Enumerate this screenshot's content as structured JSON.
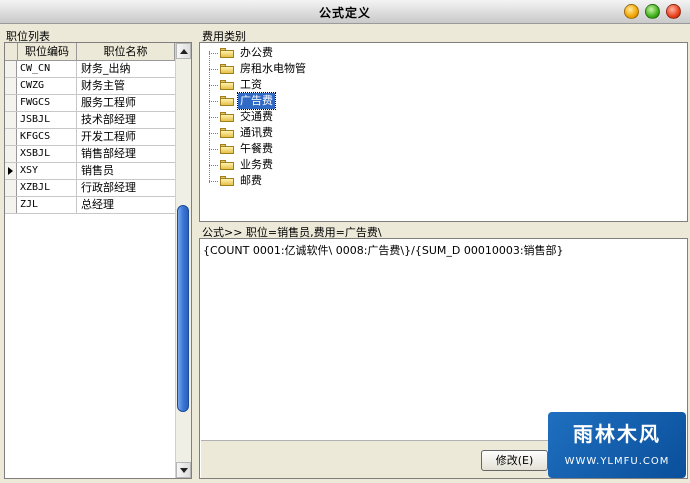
{
  "window": {
    "title": "公式定义"
  },
  "left_group": {
    "label": "职位列表",
    "columns": [
      "职位编码",
      "职位名称"
    ],
    "rows": [
      {
        "code": "CW_CN",
        "name": "财务_出纳"
      },
      {
        "code": "CWZG",
        "name": "财务主管"
      },
      {
        "code": "FWGCS",
        "name": "服务工程师"
      },
      {
        "code": "JSBJL",
        "name": "技术部经理"
      },
      {
        "code": "KFGCS",
        "name": "开发工程师"
      },
      {
        "code": "XSBJL",
        "name": "销售部经理"
      },
      {
        "code": "XSY",
        "name": "销售员",
        "current": true
      },
      {
        "code": "XZBJL",
        "name": "行政部经理"
      },
      {
        "code": "ZJL",
        "name": "总经理"
      }
    ],
    "scroll_thumb_fraction": 0.48
  },
  "expense_group": {
    "label": "费用类别",
    "items": [
      {
        "label": "办公费"
      },
      {
        "label": "房租水电物管"
      },
      {
        "label": "工资"
      },
      {
        "label": "广告费",
        "selected": true
      },
      {
        "label": "交通费"
      },
      {
        "label": "通讯费"
      },
      {
        "label": "午餐费"
      },
      {
        "label": "业务费"
      },
      {
        "label": "邮费"
      }
    ]
  },
  "formula_group": {
    "label": "公式>> 职位=销售员,费用=广告费\\",
    "text": "{COUNT 0001:亿诚软件\\ 0008:广告费\\}/{SUM_D 00010003:销售部}",
    "modify_button": "修改(E)"
  },
  "watermark": {
    "main": "雨林木风",
    "sub": "WWW.YLMFU.COM"
  },
  "colors": {
    "selection": "#316ac5",
    "scroll_thumb": "#3a78d8",
    "window_bg": "#ece9d8"
  },
  "icons": {
    "tree_item": "folder-icon",
    "current_row": "arrow-right-icon"
  }
}
